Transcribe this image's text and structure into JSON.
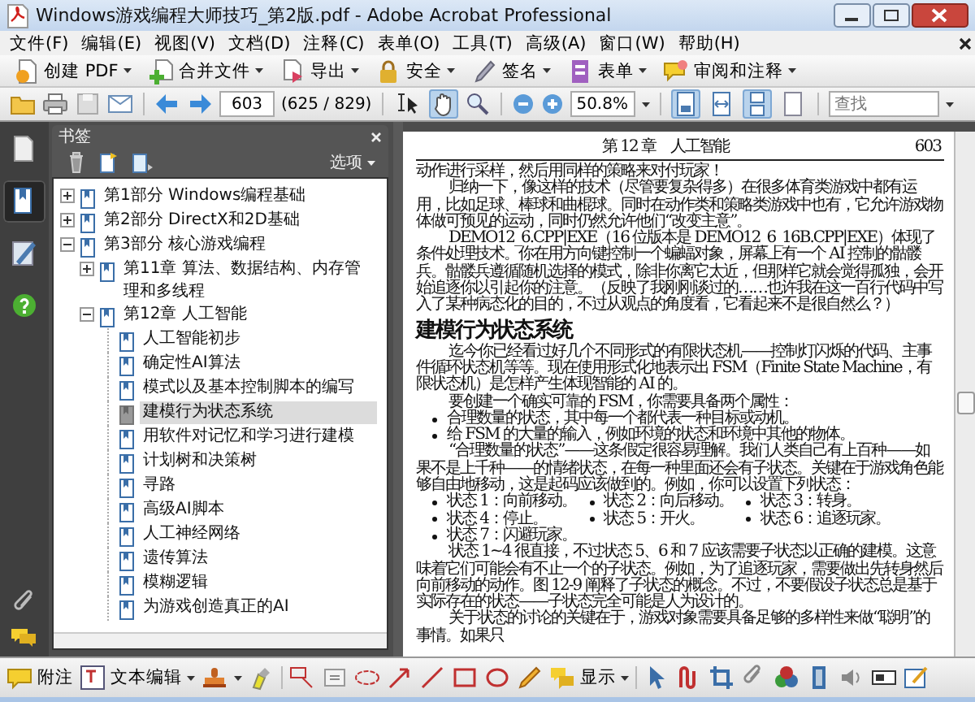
{
  "window": {
    "title": "Windows游戏编程大师技巧_第2版.pdf - Adobe Acrobat Professional"
  },
  "menu": [
    "文件(F)",
    "编辑(E)",
    "视图(V)",
    "文档(D)",
    "注释(C)",
    "表单(O)",
    "工具(T)",
    "高级(A)",
    "窗口(W)",
    "帮助(H)"
  ],
  "task_toolbar": [
    {
      "label": "创建 PDF"
    },
    {
      "label": "合并文件"
    },
    {
      "label": "导出"
    },
    {
      "label": "安全"
    },
    {
      "label": "签名"
    },
    {
      "label": "表单"
    },
    {
      "label": "审阅和注释"
    }
  ],
  "nav_toolbar": {
    "tools": [
      {
        "selected": false
      },
      {
        "selected": true
      }
    ],
    "page": "603",
    "page_count": "(625 / 829)",
    "zoom": "50.8%",
    "views": [
      {
        "selected": true
      },
      {
        "selected": false
      },
      {
        "selected": true
      },
      {
        "selected": false
      }
    ],
    "search_placeholder": "查找"
  },
  "nav_panel": {
    "buttons": [
      {
        "selected": false
      },
      {
        "selected": true
      },
      {
        "selected": false
      },
      {
        "selected": false
      }
    ]
  },
  "bookmarks": {
    "title": "书签",
    "options": "选项",
    "tree": [
      {
        "label": "第1部分 Windows编程基础",
        "kind": "group",
        "expanded": false,
        "selected": false
      },
      {
        "label": "第2部分 DirectX和2D基础",
        "kind": "group",
        "expanded": false,
        "selected": false
      },
      {
        "label": "第3部分 核心游戏编程",
        "kind": "group",
        "expanded": true,
        "selected": false,
        "children": [
          {
            "label": "第11章 算法、数据结构、内存管理和多线程",
            "kind": "group",
            "expanded": false,
            "selected": false
          },
          {
            "label": "第12章 人工智能",
            "kind": "group",
            "expanded": true,
            "selected": false,
            "children": [
              {
                "label": "人工智能初步",
                "kind": "leaf",
                "selected": false
              },
              {
                "label": "确定性AI算法",
                "kind": "leaf",
                "selected": false
              },
              {
                "label": "模式以及基本控制脚本的编写",
                "kind": "leaf",
                "selected": false
              },
              {
                "label": "建模行为状态系统",
                "kind": "leaf",
                "selected": true
              },
              {
                "label": "用软件对记忆和学习进行建模",
                "kind": "leaf",
                "selected": false
              },
              {
                "label": "计划树和决策树",
                "kind": "leaf",
                "selected": false
              },
              {
                "label": "寻路",
                "kind": "leaf",
                "selected": false
              },
              {
                "label": "高级AI脚本",
                "kind": "leaf",
                "selected": false
              },
              {
                "label": "人工神经网络",
                "kind": "leaf",
                "selected": false
              },
              {
                "label": "遗传算法",
                "kind": "leaf",
                "selected": false
              },
              {
                "label": "模糊逻辑",
                "kind": "leaf",
                "selected": false
              },
              {
                "label": "为游戏创造真正的AI",
                "kind": "leaf",
                "selected": false
              }
            ]
          }
        ]
      }
    ]
  },
  "document": {
    "header": {
      "chapter": "第 12 章　人工智能",
      "page": "603"
    },
    "blocks": [
      {
        "kind": "continued",
        "text": "动作进行采样，然后用同样的策略来对付玩家！"
      },
      {
        "kind": "para",
        "text": "归纳一下，像这样的技术（尽管要复杂得多）在很多体育类游戏中都有运用，比如足球、棒球和曲棍球。同时在动作类和策略类游戏中也有，它允许游戏物体做可预见的运动，同时仍然允许他们“改变主意”。"
      },
      {
        "kind": "para",
        "text": "DEMO12_6.CPP|EXE（16 位版本是 DEMO12_6_16B.CPP|EXE）体现了条件处理技术。你在用方向键控制一个蝙蝠对象，屏幕上有一个 AI 控制的骷髅兵。骷髅兵遵循随机选择的模式，除非你离它太近，但那样它就会觉得孤独，会开始追逐你以引起你的注意。（反映了我刚刚谈过的……也许我在这一百行代码中写入了某种病态化的目的，不过从观点的角度看，它看起来不是很自然么？）"
      },
      {
        "kind": "heading",
        "text": "建模行为状态系统"
      },
      {
        "kind": "para",
        "text": "迄今你已经看过好几个不同形式的有限状态机——控制灯闪烁的代码、主事件循环状态机等等。现在使用形式化地表示出 FSM（Finite State Machine，有限状态机）是怎样产生体现智能的 AI 的。"
      },
      {
        "kind": "para",
        "text": "要创建一个确实可靠的 FSM，你需要具备两个属性："
      },
      {
        "kind": "bullets",
        "items": [
          "合理数量的状态，其中每一个都代表一种目标或动机。",
          "给 FSM 的大量的输入，例如环境的状态和环境中其他的物体。"
        ]
      },
      {
        "kind": "para",
        "text": "“合理数量的状态”——这条假定很容易理解。我们人类自己有上百种——如果不是上千种——的情绪状态，在每一种里面还会有子状态。关键在于游戏角色能够自由地移动，这是起码应该做到的。例如，你可以设置下列状态："
      },
      {
        "kind": "bullets",
        "items": [
          "状态 1：向前移动。",
          "状态 2：向后移动。",
          "状态 3：转身。",
          "状态 4：停止。",
          "状态 5：开火。",
          "状态 6：追逐玩家。",
          "状态 7：闪避玩家。"
        ]
      },
      {
        "kind": "para",
        "text": "状态 1~4 很直接，不过状态 5、6 和 7 应该需要子状态以正确的建模。这意味着它们可能会有不止一个的子状态。例如，为了追逐玩家，需要做出先转身然后向前移动的动作。图 12-9 阐释了子状态的概念。不过，不要假设子状态总是基于实际存在的状态——子状态完全可能是人为设计的。"
      },
      {
        "kind": "para",
        "text": "关于状态的讨论的关键在于，游戏对象需要具备足够的多样性来做“聪明”的事情。如果只"
      }
    ]
  },
  "comment_toolbar": {
    "note": "附注",
    "text_edit": "文本编辑",
    "show": "显示"
  }
}
